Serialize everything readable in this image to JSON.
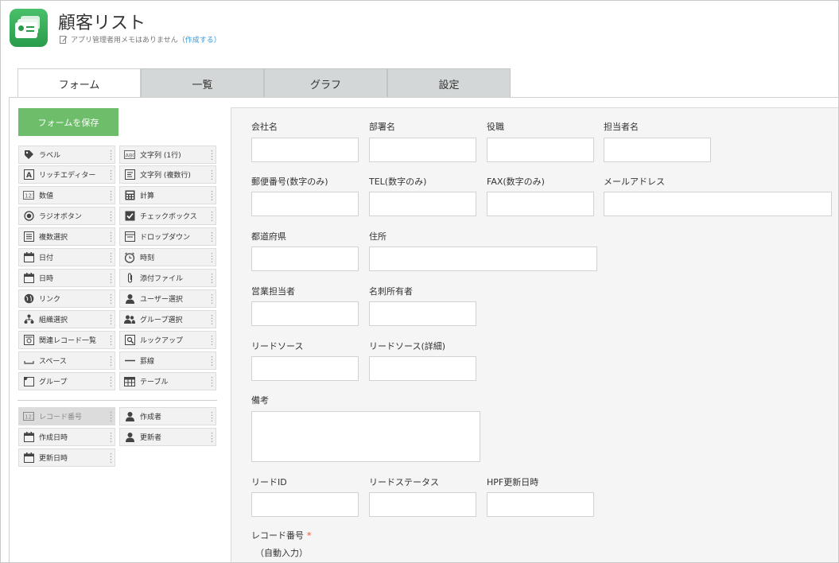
{
  "app": {
    "title": "顧客リスト",
    "memo_text": "アプリ管理者用メモはありません（",
    "memo_link": "作成する",
    "memo_close": "）"
  },
  "tabs": [
    {
      "label": "フォーム"
    },
    {
      "label": "一覧"
    },
    {
      "label": "グラフ"
    },
    {
      "label": "設定"
    }
  ],
  "save_button": "フォームを保存",
  "palette": [
    {
      "label": "ラベル",
      "icon": "tag-icon"
    },
    {
      "label": "文字列 (1行)",
      "icon": "text-single-icon"
    },
    {
      "label": "リッチエディター",
      "icon": "rich-editor-icon"
    },
    {
      "label": "文字列 (複数行)",
      "icon": "text-multi-icon"
    },
    {
      "label": "数値",
      "icon": "number-icon"
    },
    {
      "label": "計算",
      "icon": "calculator-icon"
    },
    {
      "label": "ラジオボタン",
      "icon": "radio-icon"
    },
    {
      "label": "チェックボックス",
      "icon": "checkbox-icon"
    },
    {
      "label": "複数選択",
      "icon": "multi-select-icon"
    },
    {
      "label": "ドロップダウン",
      "icon": "dropdown-icon"
    },
    {
      "label": "日付",
      "icon": "calendar-icon"
    },
    {
      "label": "時刻",
      "icon": "clock-icon"
    },
    {
      "label": "日時",
      "icon": "datetime-icon"
    },
    {
      "label": "添付ファイル",
      "icon": "paperclip-icon"
    },
    {
      "label": "リンク",
      "icon": "globe-icon"
    },
    {
      "label": "ユーザー選択",
      "icon": "user-icon"
    },
    {
      "label": "組織選択",
      "icon": "org-icon"
    },
    {
      "label": "グループ選択",
      "icon": "group-icon"
    },
    {
      "label": "関連レコード一覧",
      "icon": "related-records-icon"
    },
    {
      "label": "ルックアップ",
      "icon": "lookup-icon"
    },
    {
      "label": "スペース",
      "icon": "space-icon"
    },
    {
      "label": "罫線",
      "icon": "line-icon"
    },
    {
      "label": "グループ",
      "icon": "group-folder-icon"
    },
    {
      "label": "テーブル",
      "icon": "table-icon"
    }
  ],
  "system_fields": [
    {
      "label": "レコード番号",
      "icon": "number-icon"
    },
    {
      "label": "作成者",
      "icon": "user-icon"
    },
    {
      "label": "作成日時",
      "icon": "calendar-icon"
    },
    {
      "label": "更新者",
      "icon": "user-icon"
    },
    {
      "label": "更新日時",
      "icon": "calendar-icon"
    }
  ],
  "form": {
    "company": "会社名",
    "department": "部署名",
    "position": "役職",
    "contact_name": "担当者名",
    "postal": "郵便番号(数字のみ)",
    "tel": "TEL(数字のみ)",
    "fax": "FAX(数字のみ)",
    "email": "メールアドレス",
    "prefecture": "都道府県",
    "address": "住所",
    "sales_rep": "営業担当者",
    "card_owner": "名刺所有者",
    "lead_source": "リードソース",
    "lead_source_detail": "リードソース(詳細)",
    "notes": "備考",
    "lead_id": "リードID",
    "lead_status": "リードステータス",
    "hpf_updated": "HPF更新日時",
    "record_number": "レコード番号",
    "required_mark": "*",
    "auto_input": "（自動入力）"
  },
  "colors": {
    "accent": "#6ebd6a",
    "link": "#3498db",
    "required": "#e74c3c",
    "app_icon": "#2a9b4a"
  }
}
